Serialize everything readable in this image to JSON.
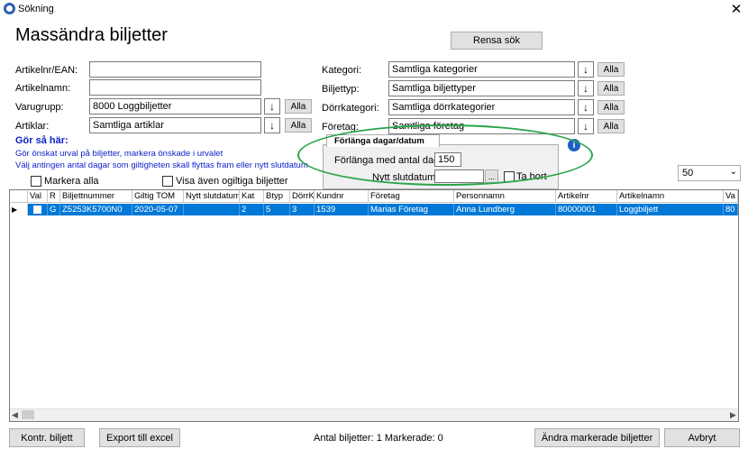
{
  "window": {
    "title": "Sökning"
  },
  "page": {
    "title": "Massändra biljetter"
  },
  "toolbar": {
    "reset_label": "Rensa sök"
  },
  "form": {
    "artikelnr_label": "Artikelnr/EAN:",
    "artikelnamn_label": "Artikelnamn:",
    "varugrupp_label": "Varugrupp:",
    "varugrupp_value": "8000 Loggbiljetter",
    "artiklar_label": "Artiklar:",
    "artiklar_value": "Samtliga artiklar",
    "kategori_label": "Kategori:",
    "kategori_value": "Samtliga kategorier",
    "biljettyp_label": "Biljettyp:",
    "biljettyp_value": "Samtliga biljettyper",
    "dorrkategori_label": "Dörrkategori:",
    "dorrkategori_value": "Samtliga dörrkategorier",
    "foretag_label": "Företag:",
    "foretag_value": "Samtliga företag",
    "arrow": "↓",
    "alla": "Alla"
  },
  "instructions": {
    "heading": "Gör så här:",
    "line1": "Gör önskat urval på biljetter, markera önskade i urvalet",
    "line2": "Välj antingen antal dagar som giltigheten skall flyttas fram eller nytt slutdatum"
  },
  "popup": {
    "tab": "Förlänga dagar/datum",
    "days_label": "Förlänga med antal dagar:",
    "days_value": "150",
    "date_label": "Nytt slutdatum:",
    "date_value": "",
    "ellipsis": "...",
    "remove_label": "Ta bort",
    "info": "i"
  },
  "options": {
    "mark_all": "Markera alla",
    "show_invalid": "Visa även ogiltiga biljetter",
    "page_size": "50"
  },
  "grid": {
    "headers": [
      "Val",
      "R",
      "Biljettnummer",
      "Giltig TOM",
      "Nytt slutdatum",
      "Kat",
      "Btyp",
      "DörrK",
      "Kundnr",
      "Företag",
      "Personnamn",
      "Artikelnr",
      "Artikelnamn",
      "Va"
    ],
    "row": [
      "",
      "G",
      "Z5253K5700N0",
      "2020-05-07",
      "",
      "2",
      "5",
      "3",
      "1539",
      "Marias Företag",
      "Anna  Lundberg",
      "80000001",
      "Loggbiljett",
      "80"
    ]
  },
  "footer": {
    "kontr_label": "Kontr. biljett",
    "export_label": "Export till excel",
    "status": "Antal biljetter: 1 Markerade: 0",
    "change_label": "Ändra markerade biljetter",
    "cancel_label": "Avbryt"
  }
}
